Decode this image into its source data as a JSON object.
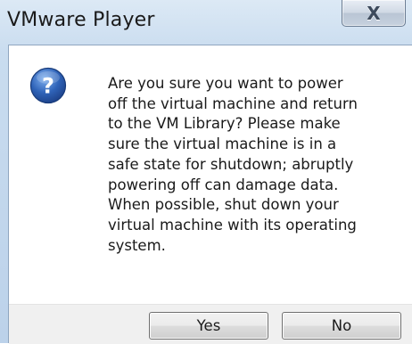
{
  "window": {
    "title": "VMware Player",
    "close_glyph": "X"
  },
  "dialog": {
    "icon": "question-icon",
    "icon_color": "#2f63b8",
    "message": "Are you sure you want to power\noff the virtual machine and return\nto the VM Library? Please make\nsure the virtual machine is in a\nsafe state for shutdown; abruptly\npowering off can damage data.\nWhen possible, shut down your\nvirtual machine with its operating\nsystem."
  },
  "buttons": {
    "yes_label": "Yes",
    "no_label": "No"
  }
}
